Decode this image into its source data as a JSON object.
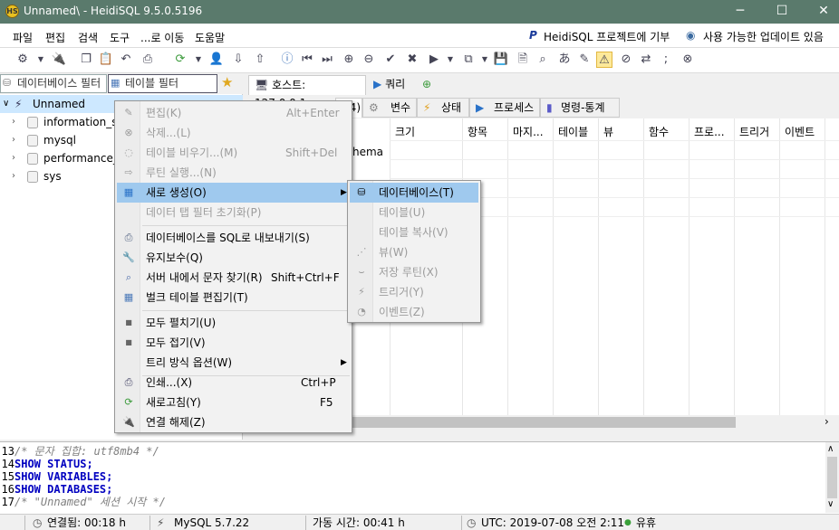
{
  "window": {
    "title": "Unnamed\\ - HeidiSQL 9.5.0.5196",
    "app_icon": "HS",
    "minimize": "─",
    "maximize": "☐",
    "close": "✕"
  },
  "menubar": {
    "items": [
      "파일",
      "편집",
      "검색",
      "도구",
      "...로 이동",
      "도움말"
    ],
    "right_links": [
      "HeidiSQL 프로젝트에 기부",
      "사용 가능한 업데이트 있음"
    ]
  },
  "filters": {
    "db_filter_placeholder": "데이터베이스 필터",
    "table_filter_placeholder": "테이블 필터"
  },
  "tree": {
    "root": "Unnamed",
    "databases": [
      "information_sc",
      "mysql",
      "performance_s",
      "sys"
    ]
  },
  "top_tabs": [
    "호스트: 127.0.0.1",
    "쿼리"
  ],
  "sub_tabs": [
    "(4)",
    "변수",
    "상태",
    "프로세스",
    "명령-통계"
  ],
  "grid": {
    "headers": [
      "크기",
      "항목",
      "마지...",
      "테이블",
      "뷰",
      "함수",
      "프로...",
      "트리거",
      "이벤트"
    ],
    "partial_cell": "hema"
  },
  "context_menu": {
    "items": [
      {
        "label": "편집(K)",
        "shortcut": "Alt+Enter",
        "disabled": true,
        "icon": "edit-icon"
      },
      {
        "label": "삭제...(L)",
        "shortcut": "",
        "disabled": true,
        "icon": "delete-icon"
      },
      {
        "label": "테이블 비우기...(M)",
        "shortcut": "Shift+Del",
        "disabled": true,
        "icon": "empty-table-icon"
      },
      {
        "label": "루틴 실행...(N)",
        "shortcut": "",
        "disabled": true,
        "icon": "run-routine-icon"
      },
      {
        "label": "새로 생성(O)",
        "shortcut": "",
        "disabled": false,
        "icon": "create-new-icon",
        "submenu": true,
        "selected": true
      },
      {
        "label": "데이터 탭 필터 초기화(P)",
        "shortcut": "",
        "disabled": true,
        "icon": ""
      },
      {
        "label": "데이터베이스를 SQL로 내보내기(S)",
        "shortcut": "",
        "disabled": false,
        "icon": "export-sql-icon"
      },
      {
        "label": "유지보수(Q)",
        "shortcut": "",
        "disabled": false,
        "icon": "wrench-icon"
      },
      {
        "label": "서버 내에서 문자 찾기(R)",
        "shortcut": "Shift+Ctrl+F",
        "disabled": false,
        "icon": "search-icon"
      },
      {
        "label": "벌크 테이블 편집기(T)",
        "shortcut": "",
        "disabled": false,
        "icon": "bulk-edit-icon"
      },
      {
        "label": "모두 펼치기(U)",
        "shortcut": "",
        "disabled": false,
        "icon": "expand-icon"
      },
      {
        "label": "모두 접기(V)",
        "shortcut": "",
        "disabled": false,
        "icon": "collapse-icon"
      },
      {
        "label": "트리 방식 옵션(W)",
        "shortcut": "",
        "disabled": false,
        "icon": "",
        "submenu": true
      },
      {
        "label": "인쇄...(X)",
        "shortcut": "Ctrl+P",
        "disabled": false,
        "icon": "printer-icon"
      },
      {
        "label": "새로고침(Y)",
        "shortcut": "F5",
        "disabled": false,
        "icon": "refresh-icon"
      },
      {
        "label": "연결 해제(Z)",
        "shortcut": "",
        "disabled": false,
        "icon": "disconnect-icon"
      }
    ]
  },
  "submenu": {
    "items": [
      {
        "label": "데이터베이스(T)",
        "disabled": false,
        "selected": true
      },
      {
        "label": "테이블(U)",
        "disabled": true
      },
      {
        "label": "테이블 복사(V)",
        "disabled": true
      },
      {
        "label": "뷰(W)",
        "disabled": true
      },
      {
        "label": "저장 루틴(X)",
        "disabled": true
      },
      {
        "label": "트리거(Y)",
        "disabled": true
      },
      {
        "label": "이벤트(Z)",
        "disabled": true
      }
    ]
  },
  "sql_log": [
    {
      "n": "13",
      "text": "/* 문자 집합: utf8mb4 */",
      "type": "comment"
    },
    {
      "n": "14",
      "text": "SHOW STATUS;",
      "type": "kw"
    },
    {
      "n": "15",
      "text": "SHOW VARIABLES;",
      "type": "kw"
    },
    {
      "n": "16",
      "text": "SHOW DATABASES;",
      "type": "kw"
    },
    {
      "n": "17",
      "text": "/* \"Unnamed\" 세션 시작 */",
      "type": "comment"
    }
  ],
  "status": {
    "connected": "연결됨: 00:18 h",
    "server": "MySQL 5.7.22",
    "uptime": "가동 시간: 00:41 h",
    "time": "UTC: 2019-07-08 오전 2:11",
    "idle": "유휴"
  }
}
